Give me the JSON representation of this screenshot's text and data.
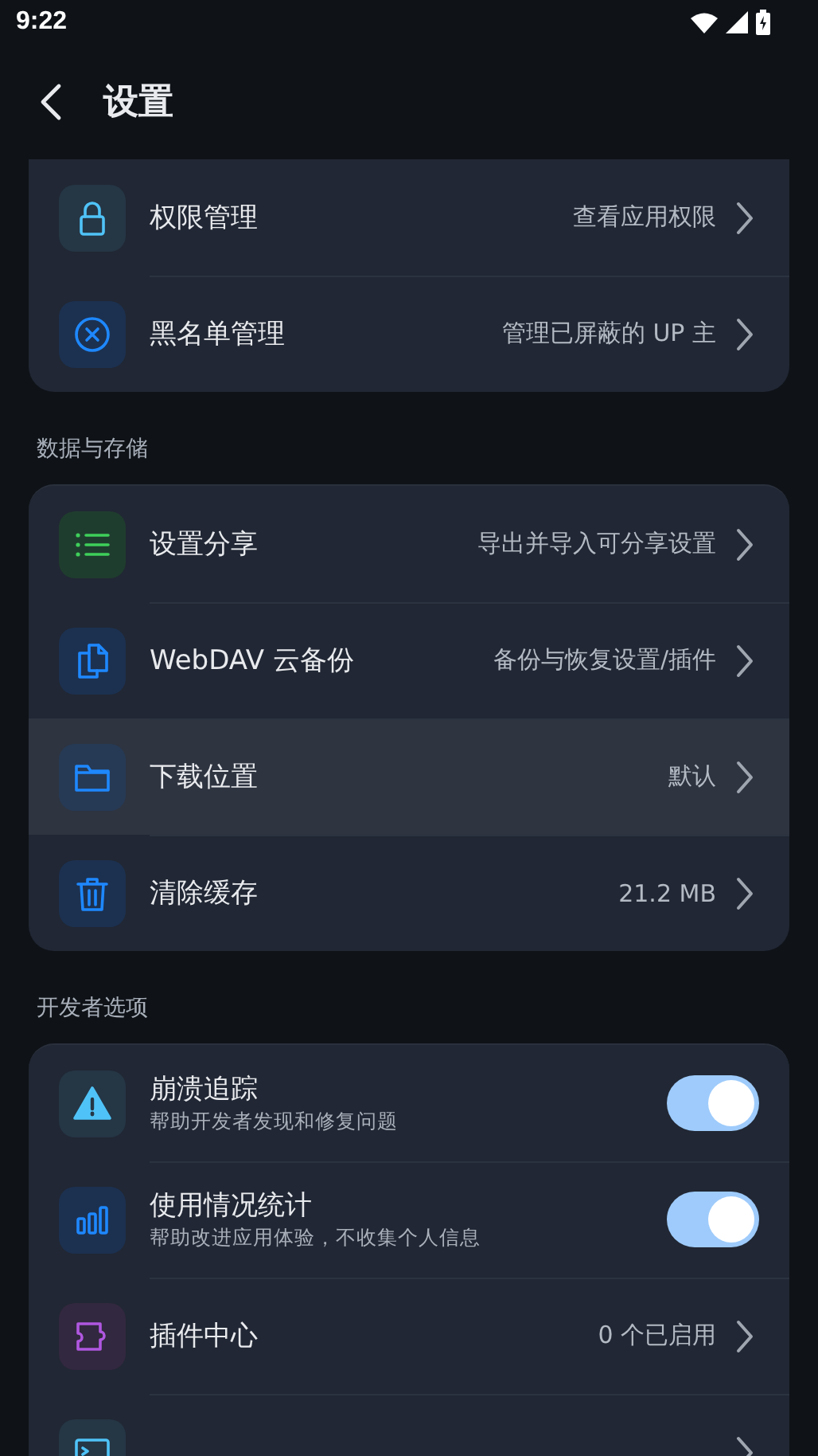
{
  "status_bar": {
    "time": "9:22"
  },
  "header": {
    "title": "设置"
  },
  "sections": [
    {
      "items": [
        {
          "kind": "link",
          "title": "权限管理",
          "value": "查看应用权限",
          "highlighted": false
        },
        {
          "kind": "link",
          "title": "黑名单管理",
          "value": "管理已屏蔽的 UP 主",
          "highlighted": false
        }
      ]
    },
    {
      "label": "数据与存储",
      "items": [
        {
          "kind": "link",
          "title": "设置分享",
          "value": "导出并导入可分享设置",
          "highlighted": false
        },
        {
          "kind": "link",
          "title": "WebDAV 云备份",
          "value": "备份与恢复设置/插件",
          "highlighted": false
        },
        {
          "kind": "link",
          "title": "下载位置",
          "value": "默认",
          "highlighted": true
        },
        {
          "kind": "link",
          "title": "清除缓存",
          "value": "21.2 MB",
          "highlighted": false
        }
      ]
    },
    {
      "label": "开发者选项",
      "items": [
        {
          "kind": "toggle",
          "title": "崩溃追踪",
          "subtitle": "帮助开发者发现和修复问题",
          "on": true,
          "highlighted": false
        },
        {
          "kind": "toggle",
          "title": "使用情况统计",
          "subtitle": "帮助改进应用体验，不收集个人信息",
          "on": true,
          "highlighted": false
        },
        {
          "kind": "link",
          "title": "插件中心",
          "value": "0 个已启用",
          "highlighted": false
        },
        {
          "kind": "link",
          "highlighted": false
        }
      ]
    }
  ]
}
